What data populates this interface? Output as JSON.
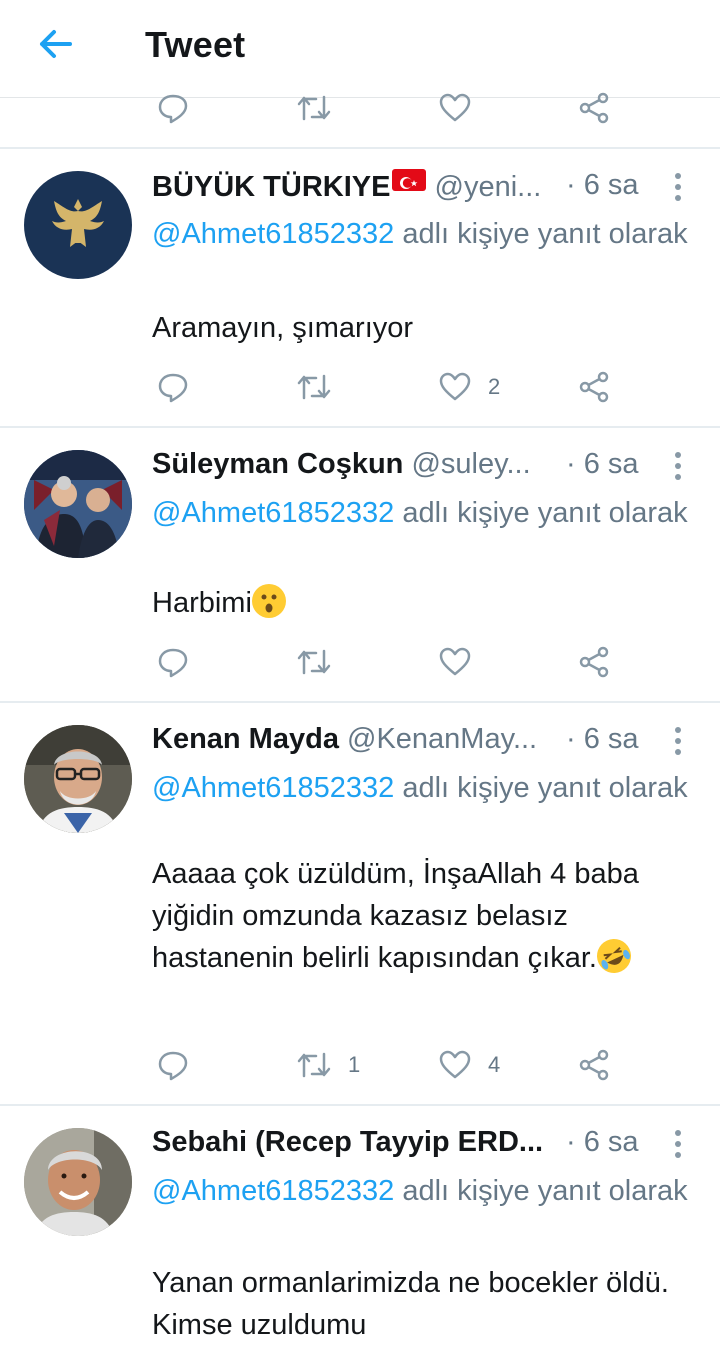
{
  "header": {
    "title": "Tweet"
  },
  "colors": {
    "accent": "#1da1f2",
    "muted": "#657786",
    "text": "#14171a",
    "divider": "#e6ecf0"
  },
  "tweets": [
    {
      "name": "BÜYÜK TÜRKIYE",
      "handle": "@yeni...",
      "time": "· 6 sa",
      "reply_prefix": "@Ahmet61852332",
      "reply_suffix": " adlı kişiye yanıt olarak",
      "text": "Aramayın, şımarıyor",
      "retweets": "",
      "likes": "2"
    },
    {
      "name": "Süleyman Coşkun",
      "handle": "@suley...",
      "time": "· 6 sa",
      "reply_prefix": "@Ahmet61852332",
      "reply_suffix": " adlı kişiye yanıt olarak",
      "text": "Harbimi",
      "retweets": "",
      "likes": ""
    },
    {
      "name": "Kenan Mayda",
      "handle": "@KenanMay...",
      "time": "· 6 sa",
      "reply_prefix": "@Ahmet61852332",
      "reply_suffix": " adlı kişiye yanıt olarak",
      "text": "Aaaaa çok üzüldüm, İnşaAllah 4 baba yiğidin omzunda kazasız belasız hastanenin belirli kapısından çıkar.",
      "retweets": "1",
      "likes": "4"
    },
    {
      "name": "Sebahi (Recep Tayyip ERD...",
      "handle": "",
      "time": "· 6 sa",
      "reply_prefix": "@Ahmet61852332",
      "reply_suffix": " adlı kişiye yanıt olarak",
      "text": "Yanan ormanlarimizda ne bocekler öldü. Kimse uzuldumu",
      "retweets": "",
      "likes": ""
    }
  ],
  "icons": [
    "back-arrow-icon",
    "reply-icon",
    "retweet-icon",
    "like-icon",
    "share-icon",
    "more-icon"
  ]
}
